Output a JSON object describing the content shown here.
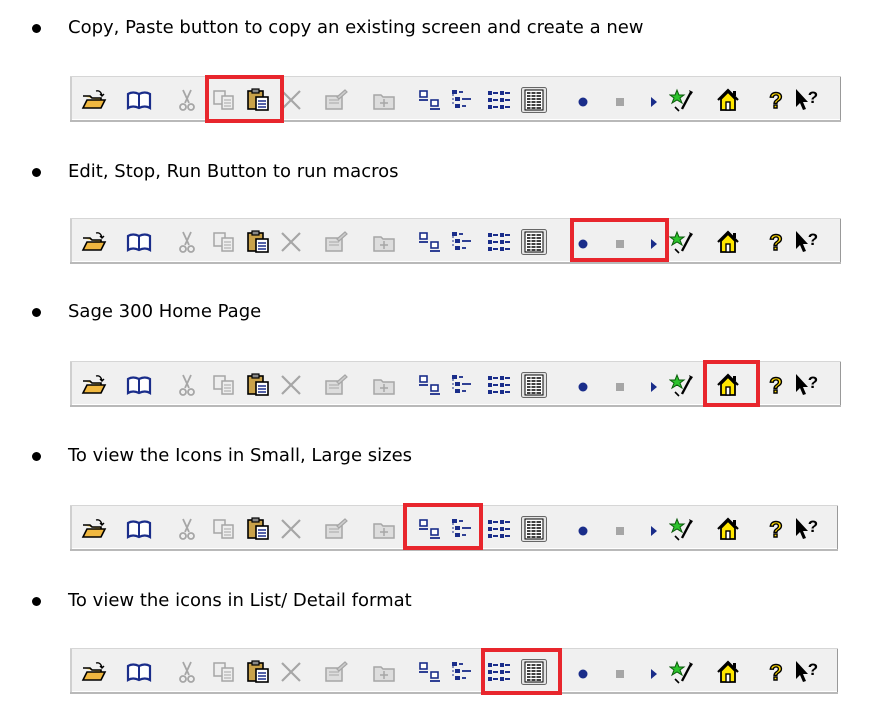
{
  "sections": [
    {
      "text": "Copy, Paste button to copy an existing screen and create a new",
      "highlight": [
        "copy",
        "paste"
      ]
    },
    {
      "text": "Edit, Stop, Run Button to run macros",
      "highlight": [
        "record",
        "stop",
        "run"
      ]
    },
    {
      "text": "Sage 300 Home Page",
      "highlight": [
        "home"
      ]
    },
    {
      "text": "To view the Icons in Small, Large sizes",
      "highlight": [
        "small-icons",
        "large-icons"
      ]
    },
    {
      "text": "To view the icons in List/ Detail format",
      "highlight": [
        "list",
        "details"
      ]
    }
  ],
  "toolbar_icons": [
    "open-folder-icon",
    "book-icon",
    "cut-icon",
    "copy-icon",
    "paste-icon",
    "delete-icon",
    "properties-icon",
    "new-folder-icon",
    "small-icons-icon",
    "large-icons-icon",
    "list-view-icon",
    "details-view-icon",
    "record-macro-icon",
    "stop-macro-icon",
    "run-macro-icon",
    "customize-icon",
    "home-icon",
    "help-icon",
    "whats-this-help-icon"
  ],
  "colors": {
    "highlight": "#e8262d",
    "icon_blue": "#1a2d8a",
    "disabled_gray": "#a6a6a6",
    "home_yellow": "#ffe600",
    "help_yellow": "#ffd800",
    "toolbar_bg": "#f0f0f0"
  }
}
